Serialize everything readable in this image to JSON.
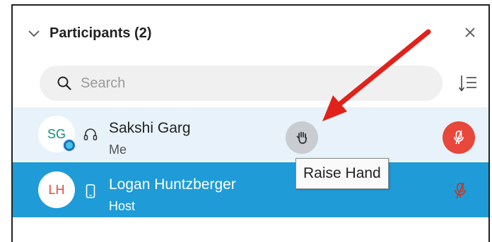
{
  "header": {
    "title": "Participants (2)"
  },
  "search": {
    "placeholder": "Search"
  },
  "participants": [
    {
      "initials": "SG",
      "name": "Sakshi Garg",
      "role": "Me",
      "device": "headset-icon"
    },
    {
      "initials": "LH",
      "name": "Logan Huntzberger",
      "role": "Host",
      "device": "phone-icon"
    }
  ],
  "tooltip": {
    "text": "Raise Hand"
  },
  "colors": {
    "selected_row": "#1f9bd7",
    "hover_row": "#e7f2fa",
    "mic_muted": "#e8473b",
    "annotation_arrow": "#e0221a"
  }
}
